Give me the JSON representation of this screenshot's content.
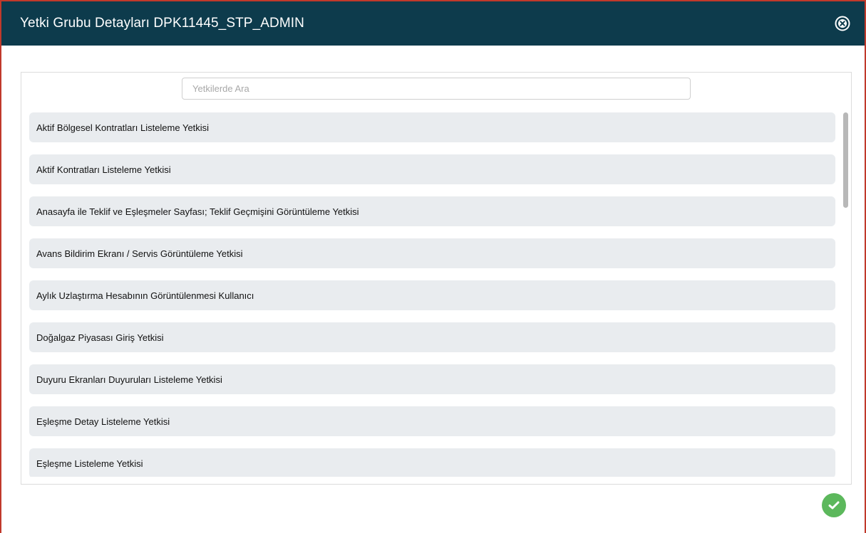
{
  "header": {
    "title": "Yetki Grubu Detayları DPK11445_STP_ADMIN",
    "close_icon": "close-circle-icon"
  },
  "search": {
    "placeholder": "Yetkilerde Ara",
    "value": ""
  },
  "permissions": [
    "Aktif Bölgesel Kontratları Listeleme Yetkisi",
    "Aktif Kontratları Listeleme Yetkisi",
    "Anasayfa ile Teklif ve Eşleşmeler Sayfası; Teklif Geçmişini Görüntüleme Yetkisi",
    "Avans Bildirim Ekranı / Servis Görüntüleme Yetkisi",
    "Aylık Uzlaştırma Hesabının Görüntülenmesi Kullanıcı",
    "Doğalgaz Piyasası Giriş Yetkisi",
    "Duyuru Ekranları Duyuruları Listeleme Yetkisi",
    "Eşleşme Detay Listeleme Yetkisi",
    "Eşleşme Listeleme Yetkisi"
  ],
  "footer": {
    "confirm_icon": "check-icon"
  },
  "colors": {
    "header_bg": "#0d3b4c",
    "item_bg": "#e9ecef",
    "confirm_bg": "#5cb85c",
    "frame_border": "#c0392b"
  }
}
